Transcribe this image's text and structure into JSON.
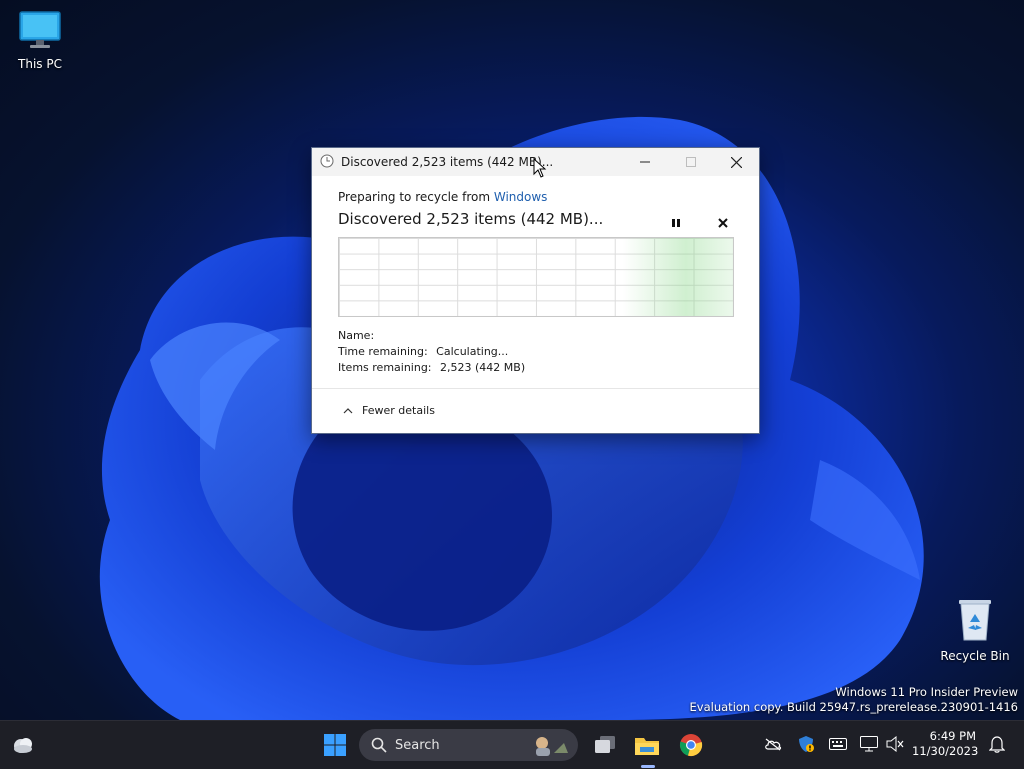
{
  "desktop": {
    "icons": [
      {
        "label": "This PC",
        "icon": "monitor-icon"
      },
      {
        "label": "Recycle Bin",
        "icon": "recycle-bin-icon"
      }
    ],
    "watermark": {
      "line1": "Windows 11 Pro Insider Preview",
      "line2": "Evaluation copy. Build 25947.rs_prerelease.230901-1416"
    }
  },
  "dialog": {
    "title": "Discovered 2,523 items (442 MB)...",
    "preparing_prefix": "Preparing to recycle from ",
    "preparing_source": "Windows",
    "status": "Discovered 2,523 items (442 MB)...",
    "details": {
      "name_label": "Name:",
      "name_value": "",
      "time_label": "Time remaining:",
      "time_value": "Calculating...",
      "items_label": "Items remaining:",
      "items_value": "2,523 (442 MB)"
    },
    "fewer_details": "Fewer details",
    "controls": {
      "pause": "pause-icon",
      "cancel": "close-icon"
    }
  },
  "taskbar": {
    "search_placeholder": "Search",
    "apps": [
      "widgets-icon",
      "start-icon",
      "task-view-icon",
      "file-explorer-icon",
      "chrome-icon"
    ],
    "tray": [
      "onedrive-icon",
      "defender-icon",
      "keyboard-icon",
      "display-icon",
      "volume-muted-icon"
    ],
    "time": "6:49 PM",
    "date": "11/30/2023",
    "notification_icon": "bell-icon"
  },
  "colors": {
    "accent_link": "#1f5fae",
    "taskbar_bg": "#1e1f26",
    "graph_fill": "#78d278"
  }
}
